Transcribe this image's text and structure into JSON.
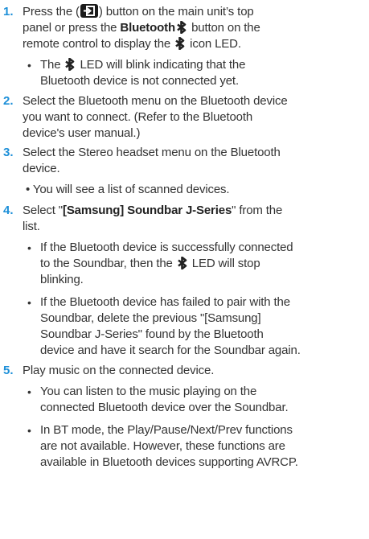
{
  "steps": [
    {
      "number": "1.",
      "line1_pre": "Press the (",
      "line1_post": ") button on the main unit’s top",
      "line2_pre": "panel or press the ",
      "line2_bold": "Bluetooth",
      "line2_post": " button on the",
      "line3_pre": "remote control to display the",
      "line3_post": "icon LED.",
      "bullets": [
        {
          "line1_pre": "The",
          "line1_post": "LED will blink indicating that the",
          "line2": "Bluetooth device is not connected yet."
        }
      ]
    },
    {
      "number": "2.",
      "lines": [
        "Select the Bluetooth menu on the Bluetooth device",
        "you want to connect. (Refer to the Bluetooth",
        "device's user manual.)"
      ]
    },
    {
      "number": "3.",
      "lines": [
        "Select the Stereo headset menu on the Bluetooth",
        "device."
      ],
      "bullet": "• You will see a list of scanned devices."
    },
    {
      "number": "4.",
      "line1_pre": "Select \"",
      "line1_bold": "[Samsung] Soundbar J-Series",
      "line1_post": "\" from the",
      "line2": "list.",
      "bullets": [
        {
          "line1": "If the Bluetooth device is successfully connected",
          "line2_pre": "to the Soundbar, then the",
          "line2_post": "LED will stop",
          "line3": "blinking."
        },
        {
          "lines": [
            "If the Bluetooth device has failed to pair with the",
            "Soundbar, delete the previous \"[Samsung]",
            "Soundbar J-Series\" found by the Bluetooth",
            "device and have it search for the Soundbar again."
          ]
        }
      ]
    },
    {
      "number": "5.",
      "line1": "Play music on the connected device.",
      "bullets": [
        {
          "lines": [
            "You can listen to the music playing on the",
            "connected Bluetooth device over the Soundbar."
          ]
        },
        {
          "lines": [
            "In BT mode, the Play/Pause/Next/Prev functions",
            "are not available. However, these functions are",
            "available in Bluetooth devices supporting AVRCP."
          ]
        }
      ]
    }
  ],
  "bullet_glyph": "•",
  "icons": {
    "input": "source-input-icon",
    "bluetooth": "bluetooth-icon"
  },
  "colors": {
    "step_number": "#1c8fd8",
    "text": "#333333"
  }
}
